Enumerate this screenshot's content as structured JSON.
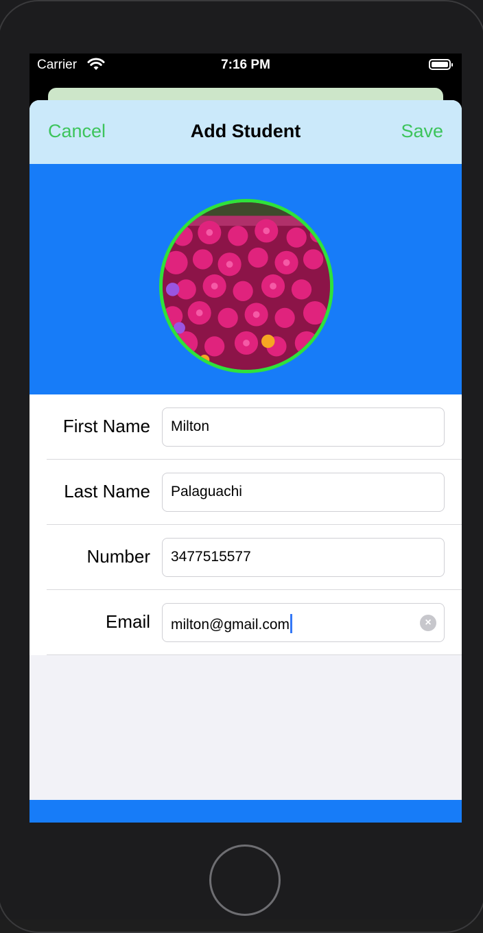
{
  "status_bar": {
    "carrier": "Carrier",
    "time": "7:16 PM",
    "wifi_icon": "wifi-icon",
    "battery_icon": "battery-icon"
  },
  "nav": {
    "cancel_label": "Cancel",
    "title": "Add Student",
    "save_label": "Save",
    "button_color": "#3dc45c"
  },
  "photo": {
    "description_icon": "student-photo",
    "border_color": "#2fe23b",
    "header_color": "#177cf8"
  },
  "form": {
    "fields": [
      {
        "label": "First Name",
        "value": "Milton"
      },
      {
        "label": "Last Name",
        "value": "Palaguachi"
      },
      {
        "label": "Number",
        "value": "3477515577"
      },
      {
        "label": "Email",
        "value": "milton@gmail.com"
      }
    ],
    "clear_icon": "clear-icon"
  }
}
